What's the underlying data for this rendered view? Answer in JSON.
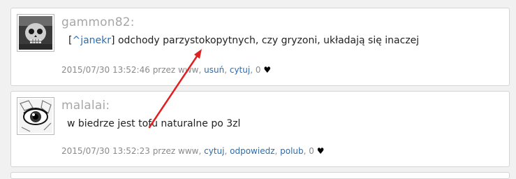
{
  "comments": [
    {
      "author": "gammon82:",
      "reply_prefix": "[",
      "reply_to": "^janekr",
      "reply_suffix": "]",
      "text": " odchody parzystokopytnych, czy gryzoni, układają się inaczej",
      "timestamp": "2015/07/30 13:52:46",
      "by_prefix": " przez ",
      "by_user": "www",
      "sep": ", ",
      "actions": [
        "usuń",
        "cytuj"
      ],
      "likes": "0",
      "heart": "♥"
    },
    {
      "author": "malalai:",
      "text": "w biedrze jest tofu naturalne po 3zl",
      "timestamp": "2015/07/30 13:52:23",
      "by_prefix": " przez ",
      "by_user": "www",
      "sep": ", ",
      "actions": [
        "cytuj",
        "odpowiedz",
        "polub"
      ],
      "likes": "0",
      "heart": "♥"
    }
  ],
  "colors": {
    "link": "#2a6db0",
    "author": "#a7a7a7",
    "arrow": "#e02020"
  },
  "icons": [
    "skull-avatar-icon",
    "eye-avatar-icon",
    "heart-icon"
  ]
}
